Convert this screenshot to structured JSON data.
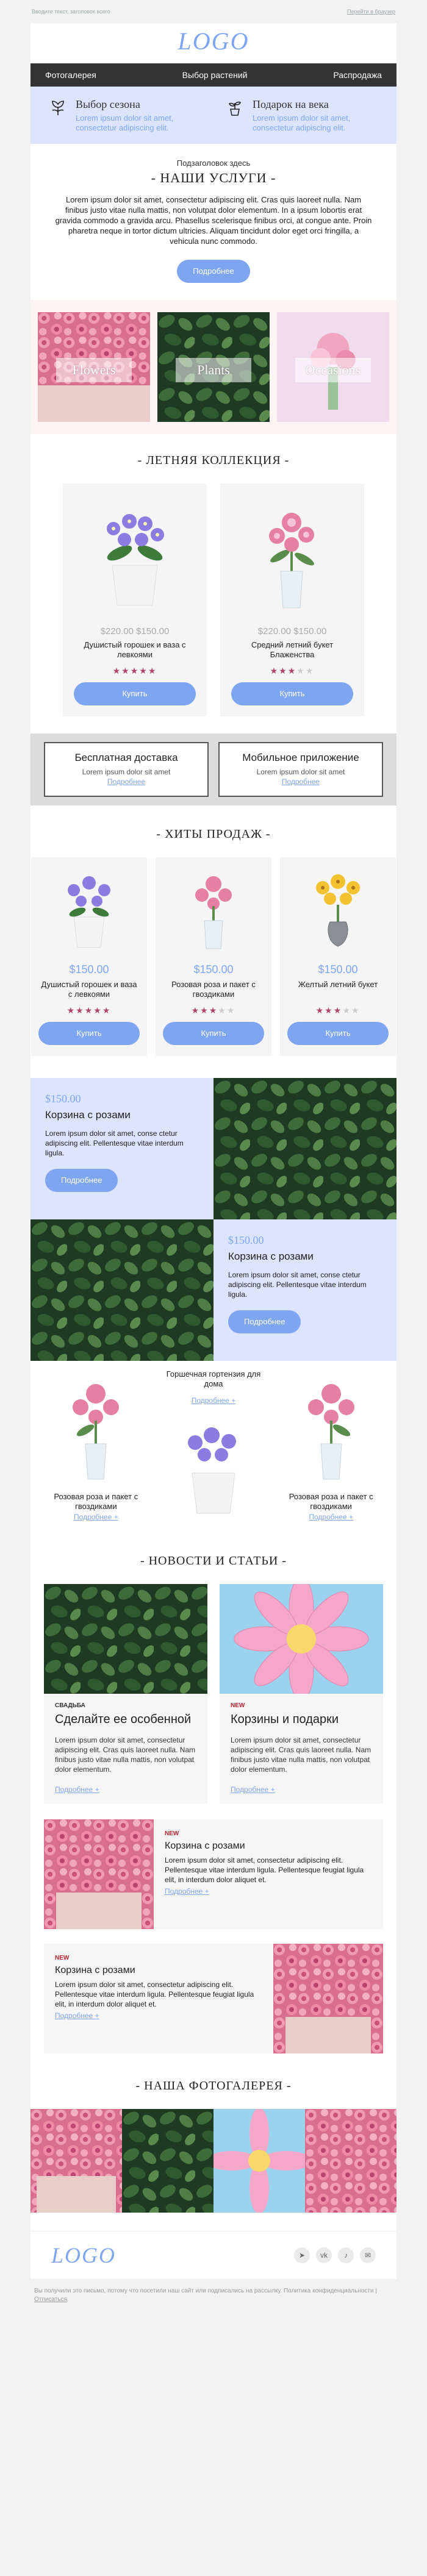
{
  "topbar": {
    "preheader": "Вводите текст, заголовок всего",
    "web_link": "Перейти в браузер"
  },
  "logo": "LOGO",
  "menu": [
    "Фотогалерея",
    "Выбор растений",
    "Распродажа"
  ],
  "benefits": [
    {
      "icon": "flower-outline-icon",
      "title": "Выбор сезона",
      "text": "Lorem ipsum dolor sit amet, consectetur adipiscing elit."
    },
    {
      "icon": "potted-plant-icon",
      "title": "Подарок на века",
      "text": "Lorem ipsum dolor sit amet, consectetur adipiscing elit."
    }
  ],
  "services": {
    "subtitle": "Подзаголовок здесь",
    "title": "- НАШИ УСЛУГИ -",
    "text": "Lorem ipsum dolor sit amet, consectetur adipiscing elit. Cras quis laoreet nulla. Nam finibus justo vitae nulla mattis, non volutpat dolor elementum. In a ipsum lobortis erat gravida commodo a gravida arcu. Phasellus scelerisque finibus orci, at congue ante. Proin pharetra neque in tortor dictum ultricies. Aliquam tincidunt dolor eget orci fringilla, a vehicula nunc commodo.",
    "button": "Подробнее"
  },
  "categories": [
    "Flowers",
    "Plants",
    "Occasions"
  ],
  "summer": {
    "title": "- ЛЕТНЯЯ КОЛЛЕКЦИЯ -",
    "items": [
      {
        "price": "$220.00 $150.00",
        "name": "Душистый горошек и ваза с левкоями",
        "rating": 5,
        "button": "Купить"
      },
      {
        "price": "$220.00 $150.00",
        "name": "Средний летний букет Блаженства",
        "rating": 3,
        "button": "Купить"
      }
    ]
  },
  "info": [
    {
      "title": "Бесплатная доставка",
      "text": "Lorem ipsum dolor sit amet",
      "link": "Подробнее"
    },
    {
      "title": "Мобильное приложение",
      "text": "Lorem ipsum dolor sit amet",
      "link": "Подробнее"
    }
  ],
  "hits": {
    "title": "- ХИТЫ ПРОДАЖ -",
    "items": [
      {
        "price": "$150.00",
        "name": "Душистый горошек и ваза с левкоями",
        "rating": 5,
        "button": "Купить"
      },
      {
        "price": "$150.00",
        "name": "Розовая роза и пакет с гвоздиками",
        "rating": 3,
        "button": "Купить"
      },
      {
        "price": "$150.00",
        "name": "Желтый летний букет",
        "rating": 3,
        "button": "Купить"
      }
    ]
  },
  "promo1": {
    "price": "$150.00",
    "name": "Корзина с розами",
    "text": "Lorem ipsum dolor sit amet, conse ctetur adipiscing elit. Pellentesque vitae interdum ligula.",
    "button": "Подробнее"
  },
  "promo2": {
    "price": "$150.00",
    "name": "Корзина с розами",
    "text": "Lorem ipsum dolor sit amet, conse ctetur adipiscing elit. Pellentesque vitae interdum ligula.",
    "button": "Подробнее"
  },
  "trio": [
    {
      "name": "Розовая роза и пакет с гвоздиками",
      "link": "Подробнее +"
    },
    {
      "name": "Горшечная гортензия для дома",
      "link": "Подробнее +"
    },
    {
      "name": "Розовая роза и пакет с гвоздиками",
      "link": "Подробнее +"
    }
  ],
  "news": {
    "title": "- НОВОСТИ И СТАТЬИ -",
    "cards": [
      {
        "tag": "СВАДЬБА",
        "title": "Сделайте ее особенной",
        "text": "Lorem ipsum dolor sit amet, consectetur adipiscing elit. Cras quis laoreet nulla. Nam finibus justo vitae nulla mattis, non volutpat dolor elementum.",
        "link": "Подробнее +"
      },
      {
        "tag": "NEW",
        "title": "Корзины и подарки",
        "text": "Lorem ipsum dolor sit amet, consectetur adipiscing elit. Cras quis laoreet nulla. Nam finibus justo vitae nulla mattis, non volutpat dolor elementum.",
        "link": "Подробнее +"
      }
    ],
    "rows": [
      {
        "tag": "NEW",
        "title": "Корзина с розами",
        "text": "Lorem ipsum dolor sit amet, consectetur adipiscing elit. Pellentesque vitae interdum ligula. Pellentesque feugiat ligula elit, in interdum dolor aliquet et.",
        "link": "Подробнее +"
      },
      {
        "tag": "NEW",
        "title": "Корзина с розами",
        "text": "Lorem ipsum dolor sit amet, consectetur adipiscing elit. Pellentesque vitae interdum ligula. Pellentesque feugiat ligula elit, in interdum dolor aliquet et.",
        "link": "Подробнее +"
      }
    ]
  },
  "gallery_title": "- НАША ФОТОГАЛЕРЕЯ -",
  "social": [
    "telegram-icon",
    "vk-icon",
    "tiktok-icon",
    "mail-icon"
  ],
  "legal": {
    "text": "Вы получили это письмо, потому что посетили наш сайт или подписались на рассылку. Политика конфиденциальности |",
    "unsubscribe": "Отписаться"
  },
  "colors": {
    "accent": "#7ea6f0",
    "light_blue": "#dce4ff",
    "star": "#b0436b",
    "dark": "#333333"
  }
}
